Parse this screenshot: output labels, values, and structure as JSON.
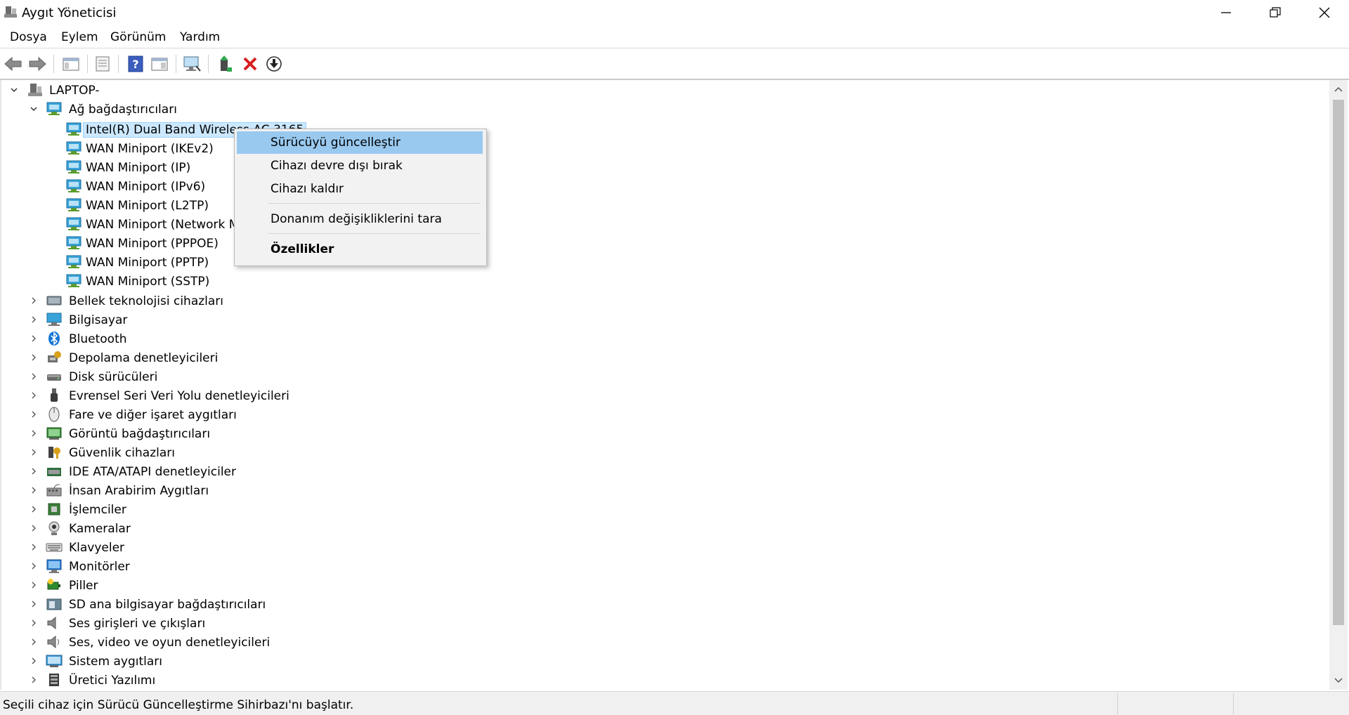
{
  "window": {
    "title": "Aygıt Yöneticisi",
    "controls": {
      "minimize": "—",
      "restore": "❐",
      "close": "✕"
    }
  },
  "menu": [
    "Dosya",
    "Eylem",
    "Görünüm",
    "Yardım"
  ],
  "toolbar": {
    "icons": [
      "back-icon",
      "forward-icon",
      "console-tree-icon",
      "properties-icon",
      "help-icon",
      "action-pane-icon",
      "scan-hardware-icon",
      "update-driver-icon",
      "uninstall-icon",
      "install-icon"
    ]
  },
  "tree": {
    "root": "LAPTOP-",
    "network_group": "Ağ bağdaştırıcıları",
    "network_children": [
      "Intel(R) Dual Band Wireless-AC 3165",
      "WAN Miniport (IKEv2)",
      "WAN Miniport (IP)",
      "WAN Miniport (IPv6)",
      "WAN Miniport (L2TP)",
      "WAN Miniport (Network Monitor)",
      "WAN Miniport (PPPOE)",
      "WAN Miniport (PPTP)",
      "WAN Miniport (SSTP)"
    ],
    "categories": [
      "Bellek teknolojisi cihazları",
      "Bilgisayar",
      "Bluetooth",
      "Depolama denetleyicileri",
      "Disk sürücüleri",
      "Evrensel Seri Veri Yolu denetleyicileri",
      "Fare ve diğer işaret aygıtları",
      "Görüntü bağdaştırıcıları",
      "Güvenlik cihazları",
      "IDE ATA/ATAPI denetleyiciler",
      "İnsan Arabirim Aygıtları",
      "İşlemciler",
      "Kameralar",
      "Klavyeler",
      "Monitörler",
      "Piller",
      "SD ana bilgisayar bağdaştırıcıları",
      "Ses girişleri ve çıkışları",
      "Ses, video ve oyun denetleyicileri",
      "Sistem aygıtları",
      "Üretici Yazılımı"
    ]
  },
  "context_menu": {
    "update_driver": "Sürücüyü güncelleştir",
    "disable": "Cihazı devre dışı bırak",
    "uninstall": "Cihazı kaldır",
    "scan": "Donanım değişikliklerini tara",
    "properties": "Özellikler"
  },
  "status": "Seçili cihaz için Sürücü Güncelleştirme Sihirbazı'nı başlatır.",
  "colors": {
    "highlight": "#99c9ef",
    "selection": "#cce8ff",
    "accent": "#2a7fd4"
  }
}
